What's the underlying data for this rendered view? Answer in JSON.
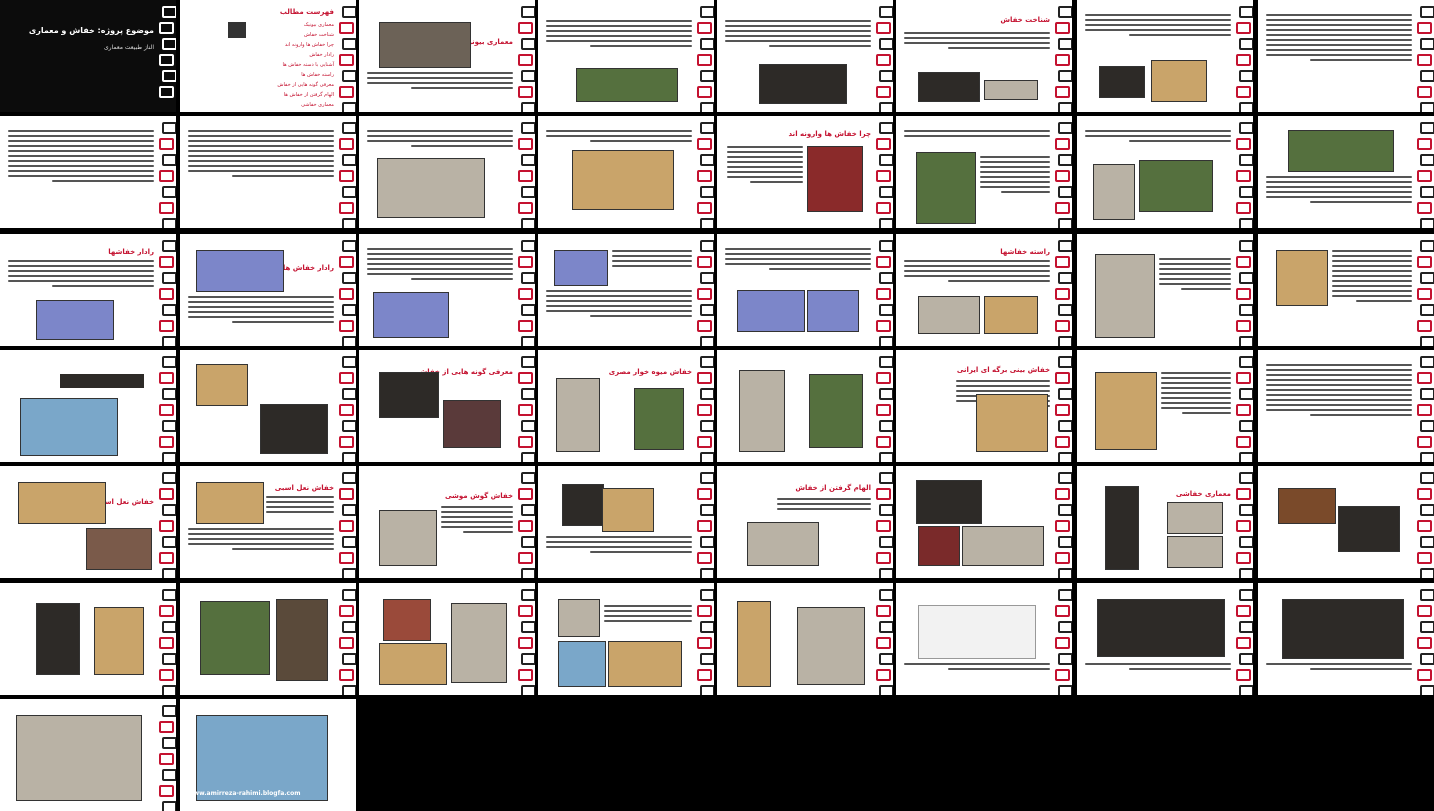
{
  "deck": {
    "title": "موضوع پروژه: خفاش و معماری",
    "author": "الناز طبیعت معماری"
  },
  "slides": {
    "toc_heading": "فهرست مطالب",
    "toc_items": [
      "معماری بیونیک",
      "شناخت خفاش",
      "چرا خفاش ها وارونه اند",
      "رادار خفاش",
      "آشنایی با دسته خفاش ها",
      "راسته خفاش ها",
      "معرفی گونه هایی از خفاش",
      "الهام گرفتن از خفاش ها",
      "معماری خفاشی"
    ],
    "titles": {
      "bionic": "معماری بیونیک",
      "knowing": "شناخت خفاش",
      "upside": "چرا خفاش ها وارونه اند",
      "radar": "رادار خفاش ها",
      "radar2": "رادار خفاشها",
      "order": "راسته خفاشها",
      "species": "معرفی گونه هایی از خفاش",
      "fruit": "خفاش میوه خوار مصری",
      "iranian": "خفاش بینی برگه ای ایرانی",
      "longear": "خفاش گوش موشی",
      "inspire": "الهام گرفتن از خفاش",
      "archbat": "معماری خفاشی",
      "horse": "خفاش نعل اسبی"
    },
    "footer": "www.amirreza-rahimi.blogfa.com"
  }
}
